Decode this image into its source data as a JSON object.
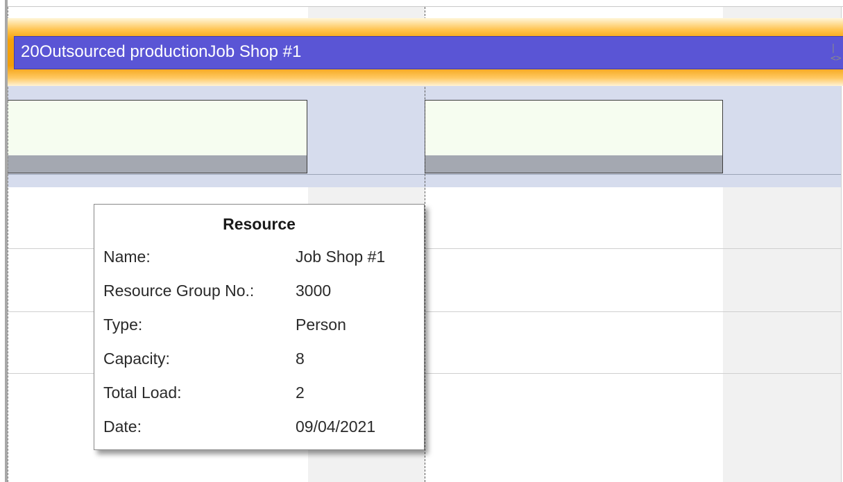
{
  "task": {
    "label": "20Outsourced productionJob Shop #1",
    "expand_glyph": "|<>",
    "bar_color": "#5a55d5",
    "highlight_color": "#f29e0a"
  },
  "tooltip": {
    "title": "Resource",
    "rows": [
      {
        "label": "Name:",
        "value": "Job Shop #1"
      },
      {
        "label": "Resource Group No.:",
        "value": "3000"
      },
      {
        "label": "Type:",
        "value": "Person"
      },
      {
        "label": "Capacity:",
        "value": "8"
      },
      {
        "label": "Total Load:",
        "value": "2"
      },
      {
        "label": "Date:",
        "value": "09/04/2021"
      }
    ]
  },
  "colors": {
    "resource_band": "#d6dced",
    "load_box": "#f6fdf0",
    "load_fill": "#a4a8b1",
    "non_working": "#f1f1f1"
  }
}
